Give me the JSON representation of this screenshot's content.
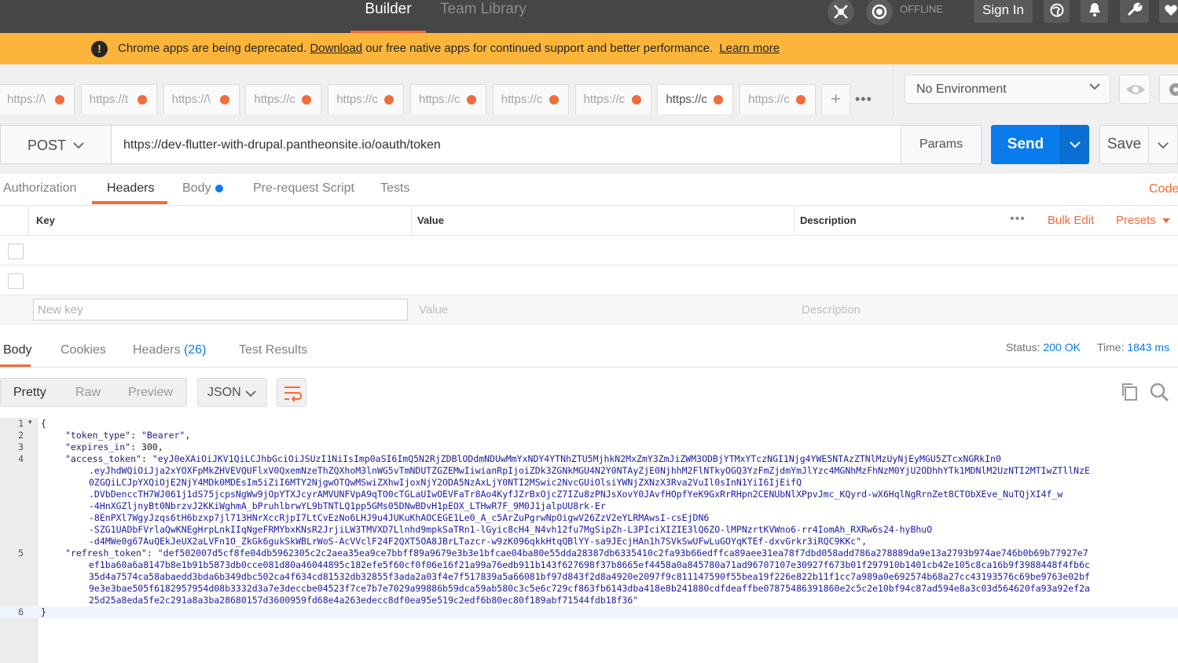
{
  "topbar": {
    "tabs": {
      "builder": "Builder",
      "team_library": "Team Library"
    },
    "offline": "OFFLINE",
    "sign_in": "Sign In"
  },
  "banner": {
    "prefix": "Chrome apps are being deprecated.",
    "download": "Download",
    "middle": "our free native apps for continued support and better performance.",
    "learn_more": "Learn more",
    "colors": {
      "background": "#fcb53b"
    }
  },
  "request_tabs": [
    {
      "label": "https://\\"
    },
    {
      "label": "https://t"
    },
    {
      "label": "https://\\"
    },
    {
      "label": "https://c"
    },
    {
      "label": "https://c"
    },
    {
      "label": "https://c"
    },
    {
      "label": "https://c"
    },
    {
      "label": "https://c"
    },
    {
      "label": "https://c",
      "active": true
    },
    {
      "label": "https://c"
    }
  ],
  "environment": {
    "selected": "No Environment"
  },
  "request": {
    "method": "POST",
    "url": "https://dev-flutter-with-drupal.pantheonsite.io/oauth/token",
    "params": "Params",
    "send": "Send",
    "save": "Save"
  },
  "request_subtabs": {
    "authorization": "Authorization",
    "headers": "Headers",
    "body": "Body",
    "prerequest": "Pre-request Script",
    "tests": "Tests",
    "code": "Code"
  },
  "headers_table": {
    "columns": {
      "key": "Key",
      "value": "Value",
      "description": "Description"
    },
    "bulk_edit": "Bulk Edit",
    "presets": "Presets",
    "new_key_placeholder": "New key",
    "new_value_placeholder": "Value",
    "new_description_placeholder": "Description"
  },
  "response": {
    "tabs": {
      "body": "Body",
      "cookies": "Cookies",
      "headers": "Headers",
      "headers_count": "(26)",
      "test_results": "Test Results"
    },
    "status_label": "Status:",
    "status_value": "200 OK",
    "time_label": "Time:",
    "time_value": "1843 ms",
    "view_modes": {
      "pretty": "Pretty",
      "raw": "Raw",
      "preview": "Preview"
    },
    "format": "JSON"
  },
  "code": {
    "line_numbers": [
      "1",
      "2",
      "3",
      "4",
      "5",
      "6"
    ],
    "open_brace": "{",
    "close_brace": "}",
    "token_type_key": "\"token_type\"",
    "token_type_val": "\"Bearer\"",
    "expires_key": "\"expires_in\"",
    "expires_val": "300",
    "access_key": "\"access_token\"",
    "access_lines": [
      "\"eyJ0eXAiOiJKV1QiLCJhbGciOiJSUzI1NiIsImp0aSI6ImQ5N2RjZDBlODdmNDUwMmYxNDY4YTNhZTU5MjhkN2MxZmY3ZmJiZWM3ODBjYTMxYTczNGI1Njg4YWE5NTAzZTNlMzUyNjEyMGU5ZTcxNGRkIn0",
      ".eyJhdWQiOiJja2xYOXFpMkZHVEVQUFlxV0QxemNzeThZQXhoM3lnWG5vTmNDUTZGZEMwIiwianRpIjoiZDk3ZGNkMGU4N2Y0NTAyZjE0NjhhM2FlNTkyOGQ3YzFmZjdmYmJlYzc4MGNhMzFhNzM0YjU2ODhhYTk1MDNlM2UzNTI2MTIwZTllNzE",
      "0ZGQiLCJpYXQiOjE2NjY4MDk0MDEsIm5iZiI6MTY2NjgwOTQwMSwiZXhwIjoxNjY2ODA5NzAxLjY0NTI2MSwic2NvcGUiOlsiYWNjZXNzX3Rva2VuIl0sInN1YiI6IjEifQ",
      ".DVbDenccTH7WJ061j1dS75jcpsNgWw9jOpYTXJcyrAMVUNFVpA9qTO0cTGLaUIwOEVFaTr8Ao4KyfJZrBxOjcZ7IZu8zPNJsXovY0JAvfHOpfYeK9GxRrRHpn2CENUbNlXPpvJmc_KQyrd-wX6HqlNgRrnZet8CTObXEve_NuTQjXI4f_w",
      "-4HnXGZljnyBt0NbrzvJ2KKiWghmA_bPruhlbrwYL9bTNTLQ1pp5GMs05DNwBDvH1pEOX_LTHwR7F_9M0J1jalpUU8rk-Er",
      "-8EnPXl7WgyJzqs6tH6bzxp7jl713HNrXccRjpI7LtCvEzNo6LHJ9u4JUKuKhAOCEGE1Le0_A_c5ArZuPgrwNpOigwV26ZzV2eYLRMAwsI-csEjDN6",
      "-SZG1UADbFVrlaQwKNEgHrpLnkIIqNgeFRMYbxKNsR2JrjiLW3TMVXD7Llnhd9mpkSaTRn1-lGyic8cH4_N4vh12fu7MgSipZh-L3PIciXIZIE3lQ6ZO-lMPNzrtKVWno6-rr4IomAh_RXRw6s24-hyBhuO",
      "-d4MWe0g67AuQEkJeUX2aLVFn1O_ZkGk6gukSkWBLrWoS-AcVVclF24F2QXT5OA8JBrLTazcr-w9zK096qkkHtqQBlYY-sa9JEcjHAn1h7SVkSwUFwLuGOYqKTEf-dxvGrkr3iRQC9KKc\","
    ],
    "refresh_key": "\"refresh_token\"",
    "refresh_lines": [
      "\"def502007d5cf8fe04db5962305c2c2aea35ea9ce7bbff89a9679e3b3e1bfcae04ba80e55dda28387db6335410c2fa93b66edffca89aee31ea78f7dbd058add786a278889da9e13a2793b974ae746b0b69b77927e7",
      "ef1ba60a6a8147b8e1b91b5873db0cce081d80a46044895c182efe5f60cf0f06e16f21a99a76edb911b143f627698f37b8665ef4458a0a845780a71ad96707107e30927f673b01f297910b1401cb42e105c8ca16b9f3988448f4fb6c",
      "35d4a7574ca58abaedd3bda6b349dbc502ca4f634cd81532db32855f3ada2a03f4e7f517839a5a66081bf97d843f2d8a4920e2097f9c811147590f55bea19f226e822b11f1cc7a989a0e692574b68a27cc43193576c69be9763e02bf",
      "9e3e3bae505f6182957954d08b3332d3a7e3deccbe04523f7ce7b7e7029a99886b59dca59ab580c3c5e6c729cf863fb6143dba418e8b241880cdfdeaffbe07875486391860e2c5c2e10bf94c87ad594e8a3c03d564620fa93a92ef2a",
      "25d25a8eda5fe2c291a8a3ba28680157d3600959fd68e4a263edecc8df0ea95e519c2edf6b80ec80f189abf71544fdb18f36\""
    ]
  }
}
